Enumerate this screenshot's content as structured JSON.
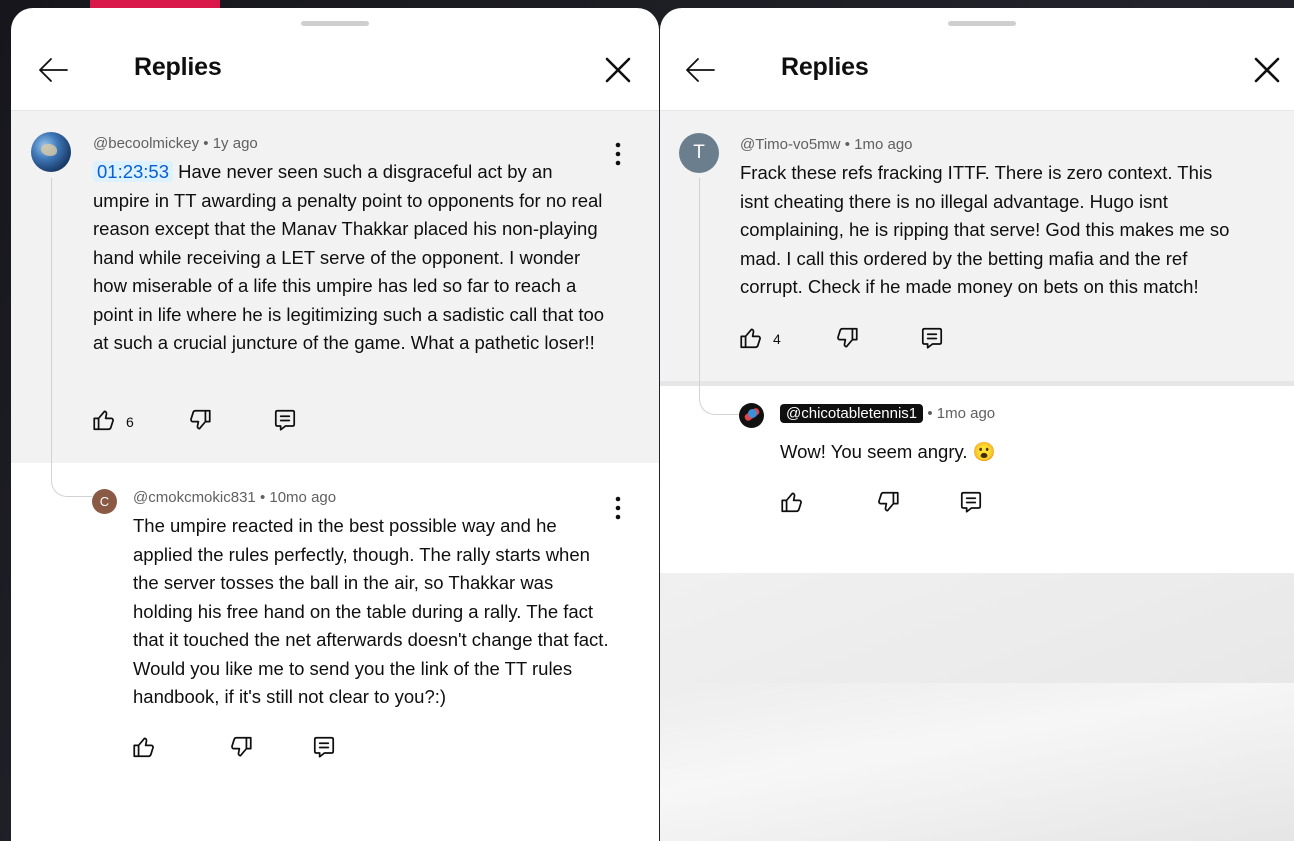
{
  "left_panel": {
    "title": "Replies",
    "parent_comment": {
      "author": "@becoolmickey",
      "age": "1y ago",
      "timestamp_link": "01:23:53",
      "text": "Have never seen such a disgraceful act by an umpire in TT awarding a penalty point to opponents for no real reason except that the Manav Thakkar placed his non-playing hand while receiving a LET serve of the opponent. I wonder how miserable of a life this umpire has led so far to reach a point in life where he is legitimizing such a sadistic call that too at such a crucial juncture of the game. What a pathetic loser!!",
      "likes": "6"
    },
    "reply": {
      "avatar_letter": "C",
      "author": "@cmokcmokic831",
      "age": "10mo ago",
      "text": "The umpire reacted in the best possible way and he applied the rules perfectly, though. The rally starts when the server tosses the ball in the air, so Thakkar was holding his free hand on the table during a rally. The fact that it touched the net afterwards doesn't change that fact. Would you like me to send you the link of the TT rules handbook, if it's still not clear to you?:)"
    }
  },
  "right_panel": {
    "title": "Replies",
    "parent_comment": {
      "avatar_letter": "T",
      "author": "@Timo-vo5mw",
      "age": "1mo ago",
      "text": "Frack these refs fracking ITTF. There is zero context. This isnt cheating there is no illegal advantage. Hugo isnt complaining, he is ripping that serve! God this makes me so mad. I call this ordered by the betting mafia and the ref corrupt. Check if he made money on bets on this match!",
      "likes": "4"
    },
    "reply": {
      "author": "@chicotabletennis1",
      "age": "1mo ago",
      "text": "Wow! You seem angry. 😮"
    }
  },
  "separator": "•",
  "icons": [
    "back-arrow-icon",
    "close-icon",
    "more-vert-icon",
    "thumb-up-icon",
    "thumb-down-icon",
    "reply-icon"
  ],
  "colors": {
    "timestamp_bg": "#def1ff",
    "timestamp_fg": "#065fd4",
    "parent_bg": "#f2f2f2",
    "accent": "#d8194a"
  }
}
